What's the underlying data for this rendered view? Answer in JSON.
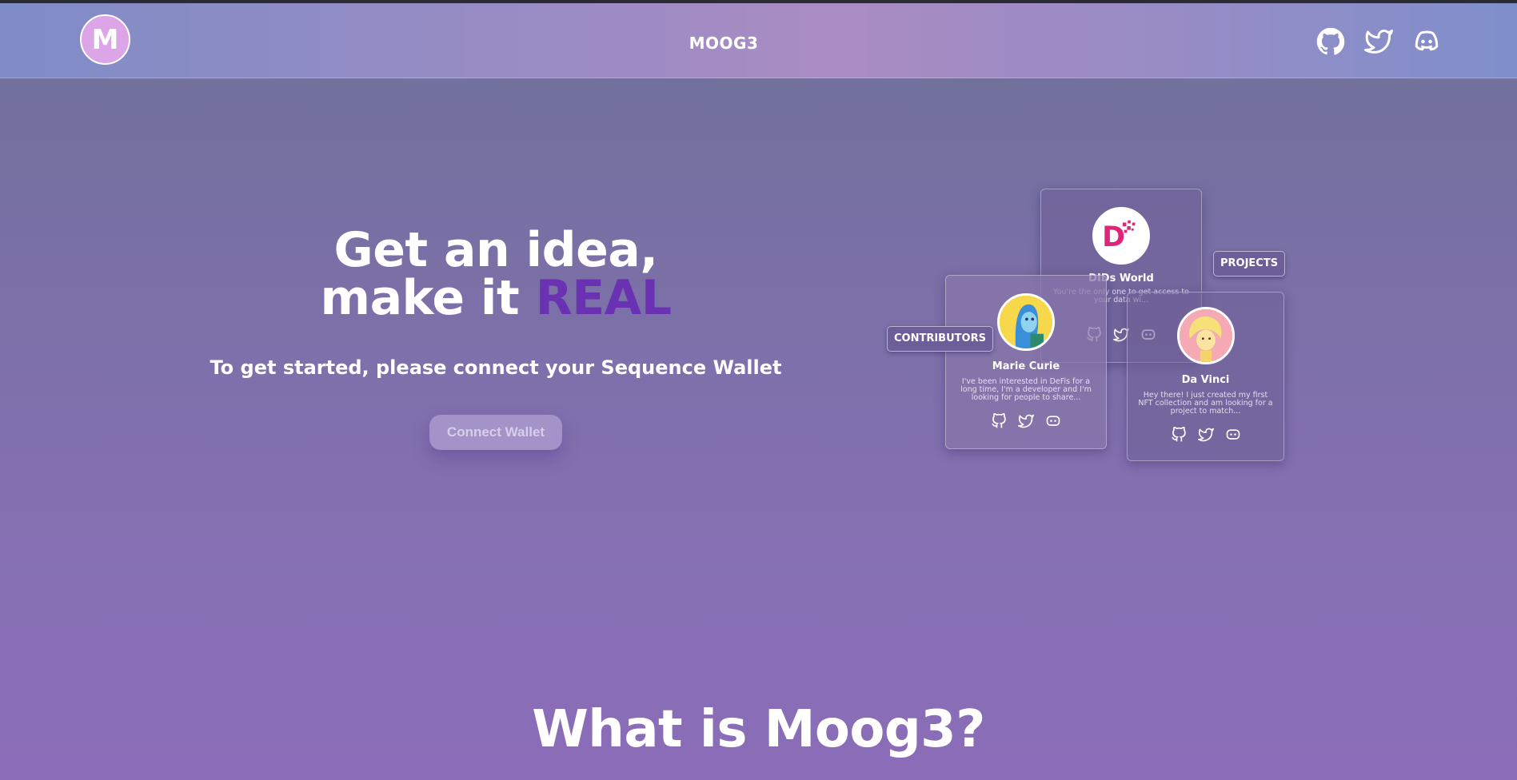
{
  "header": {
    "logo_letter": "M",
    "brand": "MOOG3",
    "social": [
      "github-icon",
      "twitter-icon",
      "discord-icon"
    ]
  },
  "hero": {
    "title_line1": "Get an idea,",
    "title_line2_prefix": "make it ",
    "title_line2_accent": "REAL",
    "subtitle": "To get started, please connect your Sequence Wallet",
    "connect_button": "Connect Wallet"
  },
  "cards": {
    "dids": {
      "name": "DIDs World",
      "bio": "You're the only one to get access to your data wi..."
    },
    "marie": {
      "name": "Marie Curie",
      "bio": "I've been interested in DeFis for a long time, I'm a developer and I'm looking for people to share..."
    },
    "davinci": {
      "name": "Da Vinci",
      "bio": "Hey there! I just created my first NFT collection and am looking for a project to match..."
    },
    "tags": {
      "contributors": "CONTRIBUTORS",
      "projects": "PROJECTS"
    }
  },
  "section": {
    "title": "What is Moog3?"
  },
  "colors": {
    "accent": "#6a32b3",
    "logo_bg": "#dca5e8",
    "button_bg": "#a493c9"
  }
}
